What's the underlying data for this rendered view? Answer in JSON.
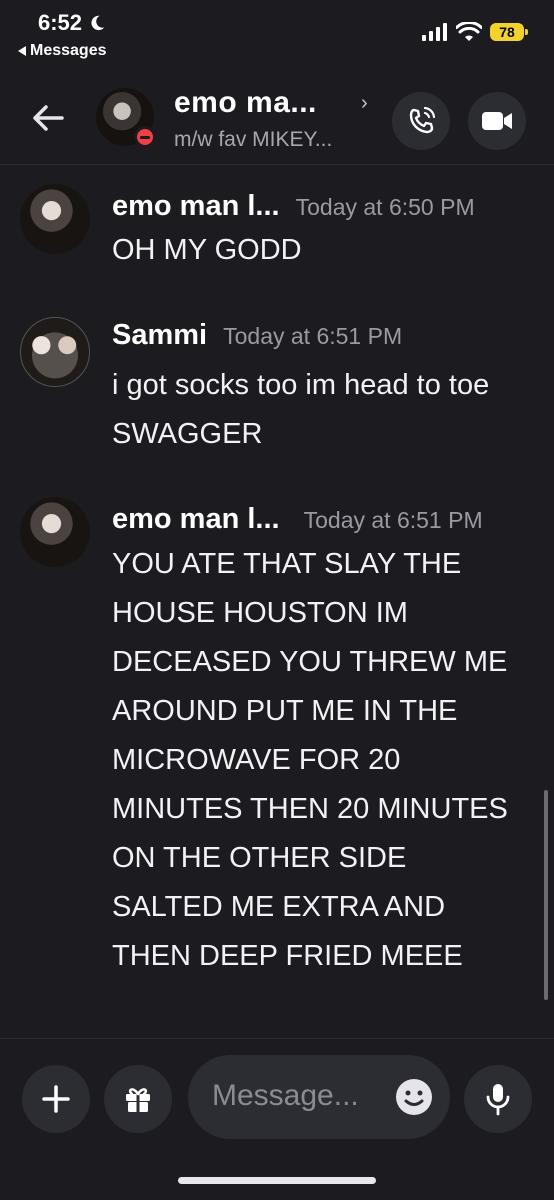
{
  "status_bar": {
    "time": "6:52",
    "back_app": "Messages",
    "battery": "78"
  },
  "header": {
    "title": "emo ma...",
    "subtitle": "m/w fav MIKEY..."
  },
  "messages": [
    {
      "author": "emo man l...",
      "timestamp": "Today at 6:50 PM",
      "text": "OH MY GODD"
    },
    {
      "author": "Sammi",
      "timestamp": "Today at 6:51 PM",
      "text": "i got socks too im head to toe SWAGGER"
    },
    {
      "author": "emo man l...",
      "timestamp": "Today at 6:51 PM",
      "text": "YOU ATE THAT SLAY THE HOUSE HOUSTON IM DECEASED YOU THREW ME AROUND PUT ME IN THE MICROWAVE FOR 20 MINUTES THEN 20 MINUTES ON THE OTHER SIDE SALTED ME EXTRA AND THEN DEEP FRIED MEEE"
    }
  ],
  "composer": {
    "placeholder": "Message..."
  },
  "icons": {
    "back": "arrow-left-icon",
    "call": "phone-icon",
    "video": "video-camera-icon",
    "add": "plus-icon",
    "gift": "gift-icon",
    "emoji": "smiley-icon",
    "mic": "microphone-icon",
    "status": "do-not-disturb-icon"
  },
  "colors": {
    "background": "#1b1b20",
    "surface": "#2c2c33",
    "battery": "#f4d22e",
    "dnd": "#f23f43"
  }
}
